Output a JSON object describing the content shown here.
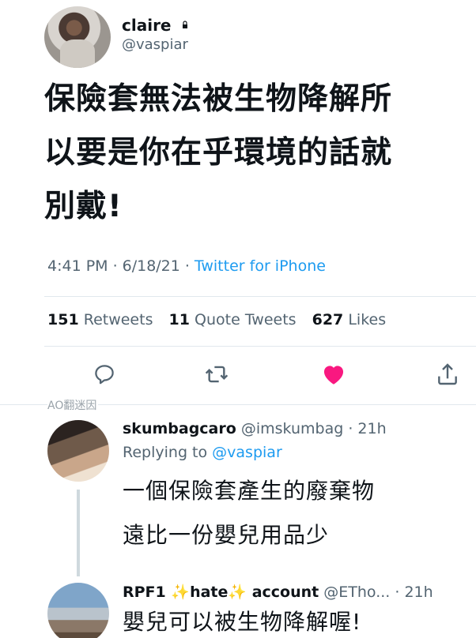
{
  "tweet": {
    "display_name": "claire",
    "handle": "@vaspiar",
    "body_lines": [
      "保險套無法被生物降解所",
      "以要是你在乎環境的話就",
      "別戴!"
    ],
    "time": "4:41 PM",
    "date": "6/18/21",
    "client": "Twitter for iPhone",
    "retweets_count": "151",
    "retweets_label": "Retweets",
    "quotes_count": "11",
    "quotes_label": "Quote Tweets",
    "likes_count": "627",
    "likes_label": "Likes"
  },
  "actions": {
    "reply_icon": "reply-icon",
    "retweet_icon": "retweet-icon",
    "like_icon": "heart-icon",
    "like_color": "#f91880",
    "share_icon": "share-icon"
  },
  "watermark": "AO翻迷因",
  "replies": [
    {
      "display_name": "skumbagcaro",
      "handle": "@imskumbag",
      "time": "· 21h",
      "replying_label": "Replying to",
      "replying_to": "@vaspiar",
      "text_lines": [
        "一個保險套產生的廢棄物",
        "遠比一份嬰兒用品少"
      ]
    },
    {
      "display_name_parts": [
        "RPF1",
        "✨",
        "hate",
        "✨",
        "account"
      ],
      "handle": "@ETho...",
      "time": "· 21h",
      "text_lines": [
        "嬰兒可以被生物降解喔!"
      ]
    }
  ],
  "colors": {
    "accent": "#1d9bf0",
    "muted": "#536471",
    "text": "#0f1419"
  }
}
